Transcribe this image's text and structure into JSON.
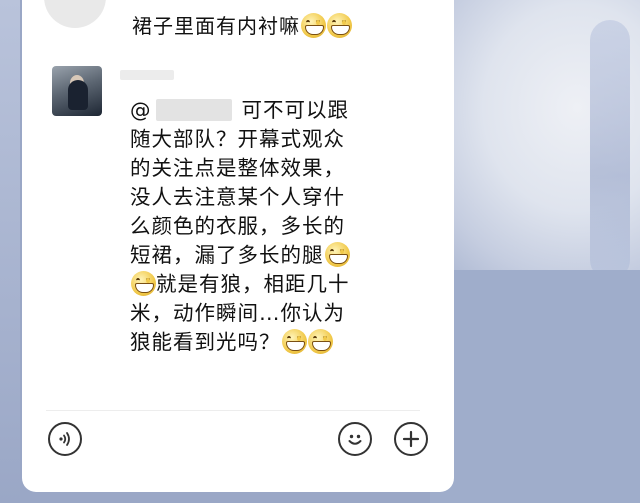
{
  "chat": {
    "top_message": {
      "text": "裙子里面有内衬嘛",
      "emojis": [
        "grin-emoji",
        "grin-emoji"
      ]
    },
    "message": {
      "mention_prefix": "@",
      "lines": [
        "可不可以跟",
        "随大部队？开幕式观众",
        "的关注点是整体效果，",
        "没人去注意某个人穿什",
        "么颜色的衣服，多长的",
        "短裙，漏了多长的腿",
        "就是有狼，相距几十",
        "米，动作瞬间…你认为",
        "狼能看到光吗？"
      ]
    }
  },
  "input_bar": {
    "voice_icon": "voice-icon",
    "emoji_icon": "emoji-icon",
    "plus_icon": "plus-icon"
  }
}
